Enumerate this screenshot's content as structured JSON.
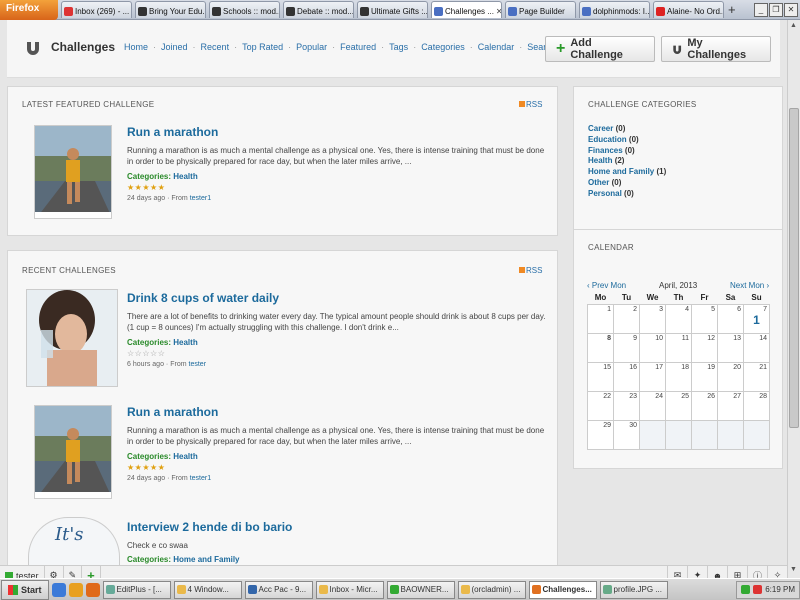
{
  "browser": {
    "firefox_button": "Firefox",
    "tabs": [
      {
        "label": "Inbox (269) - ...",
        "fav": "#d33"
      },
      {
        "label": "Bring Your Edu...",
        "fav": "#333"
      },
      {
        "label": "Schools :: mod...",
        "fav": "#333"
      },
      {
        "label": "Debate :: mod...",
        "fav": "#333"
      },
      {
        "label": "Ultimate Gifts :...",
        "fav": "#333"
      },
      {
        "label": "Challenges ...",
        "fav": "#4a6fc2",
        "active": true
      },
      {
        "label": "Page Builder",
        "fav": "#4a6fc2"
      },
      {
        "label": "dolphinmods: I...",
        "fav": "#4a6fc2"
      },
      {
        "label": "Alaine- No Ord...",
        "fav": "#d22"
      }
    ],
    "new_tab": "+"
  },
  "site": {
    "title": "Challenges",
    "nav": [
      "Home",
      "Joined",
      "Recent",
      "Top Rated",
      "Popular",
      "Featured",
      "Tags",
      "Categories",
      "Calendar",
      "Search"
    ],
    "add_button": "Add Challenge",
    "my_button": "My Challenges"
  },
  "featured": {
    "heading": "LATEST FEATURED CHALLENGE",
    "rss": "RSS",
    "item": {
      "title": "Run a marathon",
      "desc": "Running a marathon is as much a mental challenge as a physical one. Yes, there is intense training that must be done in order to be physically prepared for  race day, but when the later miles arrive, ...",
      "cat_label": "Categories:",
      "cat": "Health",
      "stars": "★★★★★",
      "ago": "24 days ago",
      "from": "From",
      "user": "tester1"
    }
  },
  "recent": {
    "heading": "RECENT CHALLENGES",
    "rss": "RSS",
    "items": [
      {
        "title": "Drink 8 cups of water daily",
        "desc": "There are a lot of benefits to drinking water every day. The typical amount people should drink is about 8 cups per day. (1 cup = 8 ounces) I'm actually struggling with this challenge. I don't drink e...",
        "cat_label": "Categories:",
        "cat": "Health",
        "stars": "☆☆☆☆☆",
        "ago": "6 hours ago",
        "from": "From",
        "user": "tester"
      },
      {
        "title": "Run a marathon",
        "desc": "Running a marathon is as much a mental challenge as a physical one. Yes, there is intense training that must be done in order to be physically prepared for  race day, but when the later miles arrive, ...",
        "cat_label": "Categories:",
        "cat": "Health",
        "stars": "★★★★★",
        "ago": "24 days ago",
        "from": "From",
        "user": "tester1"
      },
      {
        "title": "Interview 2 hende di bo bario",
        "desc": "Check e co swaa",
        "cat_label": "Categories:",
        "cat": "Home and Family",
        "thumb_text": "It's"
      }
    ]
  },
  "categories": {
    "heading": "CHALLENGE CATEGORIES",
    "items": [
      {
        "name": "Career",
        "count": "(0)"
      },
      {
        "name": "Education",
        "count": "(0)"
      },
      {
        "name": "Finances",
        "count": "(0)"
      },
      {
        "name": "Health",
        "count": "(2)"
      },
      {
        "name": "Home and Family",
        "count": "(1)"
      },
      {
        "name": "Other",
        "count": "(0)"
      },
      {
        "name": "Personal",
        "count": "(0)"
      }
    ]
  },
  "calendar": {
    "heading": "CALENDAR",
    "prev": "‹ Prev Mon",
    "month": "April, 2013",
    "next": "Next Mon ›",
    "weekdays": [
      "Mo",
      "Tu",
      "We",
      "Th",
      "Fr",
      "Sa",
      "Su"
    ],
    "weeks": [
      [
        "1",
        "2",
        "3",
        "4",
        "5",
        "6",
        "7"
      ],
      [
        "8",
        "9",
        "10",
        "11",
        "12",
        "13",
        "14"
      ],
      [
        "15",
        "16",
        "17",
        "18",
        "19",
        "20",
        "21"
      ],
      [
        "22",
        "23",
        "24",
        "25",
        "26",
        "27",
        "28"
      ],
      [
        "29",
        "30",
        "",
        "",
        "",
        "",
        ""
      ]
    ],
    "today": "8",
    "event_day": "7",
    "event_count": "1"
  },
  "userbar": {
    "username": "tester"
  },
  "taskbar": {
    "start": "Start",
    "buttons": [
      {
        "label": "EditPlus - [...",
        "ic": "#6a9"
      },
      {
        "label": "4 Window...",
        "ic": "#eab94a"
      },
      {
        "label": "Acc Pac - 9...",
        "ic": "#36a"
      },
      {
        "label": "Inbox - Micr...",
        "ic": "#eab94a"
      },
      {
        "label": "BAOWNER...",
        "ic": "#3a3"
      },
      {
        "label": "(orcladmin) ...",
        "ic": "#eab94a"
      },
      {
        "label": "Challenges...",
        "ic": "#e07020",
        "active": true
      },
      {
        "label": "profile.JPG ...",
        "ic": "#6a8"
      }
    ],
    "clock": "6:19 PM"
  }
}
